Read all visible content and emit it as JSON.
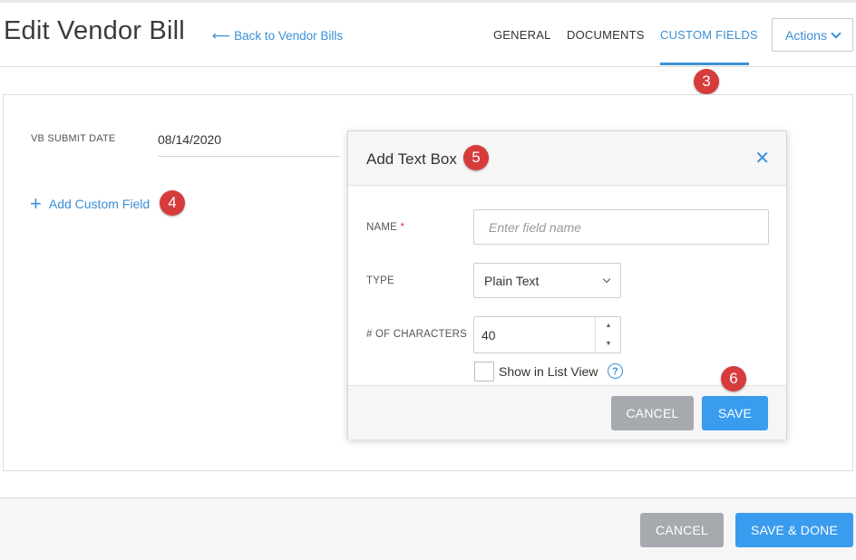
{
  "header": {
    "title": "Edit Vendor Bill",
    "back_link": "Back to Vendor Bills",
    "back_arrow": "⟵",
    "tabs": [
      {
        "label": "GENERAL",
        "active": false
      },
      {
        "label": "DOCUMENTS",
        "active": false
      },
      {
        "label": "CUSTOM FIELDS",
        "active": true
      }
    ],
    "actions_label": "Actions"
  },
  "main": {
    "field_label": "VB SUBMIT DATE",
    "field_value": "08/14/2020",
    "add_custom_field": "Add Custom Field",
    "add_icon": "+"
  },
  "modal": {
    "title": "Add Text Box",
    "close_icon": "✕",
    "name_label": "NAME",
    "required_mark": "*",
    "name_placeholder": "Enter field name",
    "type_label": "TYPE",
    "type_value": "Plain Text",
    "chars_label": "# OF CHARACTERS",
    "chars_value": "40",
    "spin_up": "▲",
    "spin_down": "▼",
    "show_in_list_label": "Show in List View",
    "help_icon": "?",
    "cancel_label": "CANCEL",
    "save_label": "SAVE"
  },
  "footer": {
    "cancel_label": "CANCEL",
    "save_done_label": "SAVE & DONE"
  },
  "annotations": [
    "3",
    "4",
    "5",
    "6"
  ],
  "colors": {
    "accent": "#3b8fd6",
    "primary_button": "#3a9cef",
    "secondary_button": "#a6aaaf",
    "badge": "#d63c3c"
  }
}
